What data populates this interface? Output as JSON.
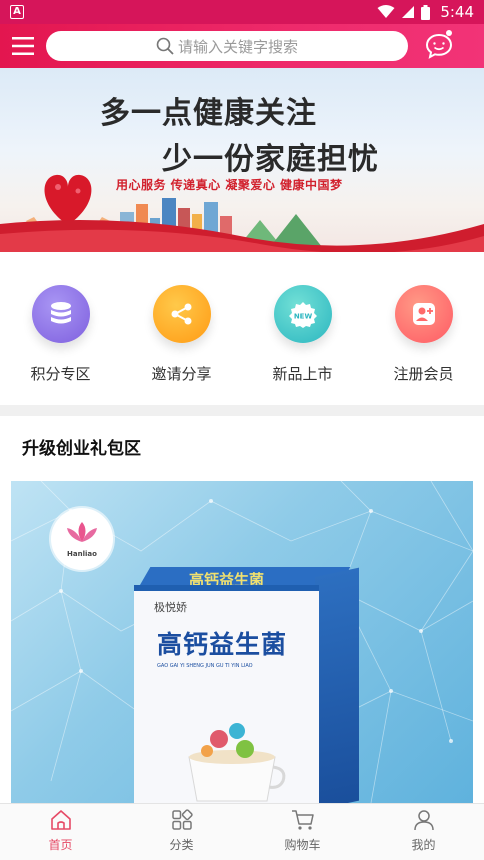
{
  "status_bar": {
    "time": "5:44",
    "notification_icon": "a-icon"
  },
  "header": {
    "search_placeholder": "请输入关键字搜索",
    "menu_icon": "menu-icon",
    "message_icon": "chat-icon"
  },
  "banner": {
    "line1": "多一点健康关注",
    "line2": "少一份家庭担忧",
    "slogan": "用心服务  传递真心  凝聚爱心  健康中国梦"
  },
  "quick_entries": [
    {
      "label": "积分专区",
      "icon": "database-icon",
      "color": "#8f74e6"
    },
    {
      "label": "邀请分享",
      "icon": "share-icon",
      "color": "#ffac1f"
    },
    {
      "label": "新品上市",
      "icon": "new-icon",
      "color": "#3cc4c4"
    },
    {
      "label": "注册会员",
      "icon": "add-user-icon",
      "color": "#ff6a6a"
    }
  ],
  "section": {
    "title": "升级创业礼包区"
  },
  "product": {
    "brand_name": "Hanliao",
    "box_top_text": "高钙益生菌",
    "box_brand": "极悦娇",
    "box_title": "高钙益生菌",
    "box_pinyin": "GAO GAI YI SHENG JUN GU TI YIN LIAO"
  },
  "bottom_nav": [
    {
      "label": "首页",
      "icon": "home-icon",
      "active": true
    },
    {
      "label": "分类",
      "icon": "category-icon",
      "active": false
    },
    {
      "label": "购物车",
      "icon": "cart-icon",
      "active": false
    },
    {
      "label": "我的",
      "icon": "user-icon",
      "active": false
    }
  ],
  "colors": {
    "accent": "#e3164f",
    "active_nav": "#e64a66"
  }
}
